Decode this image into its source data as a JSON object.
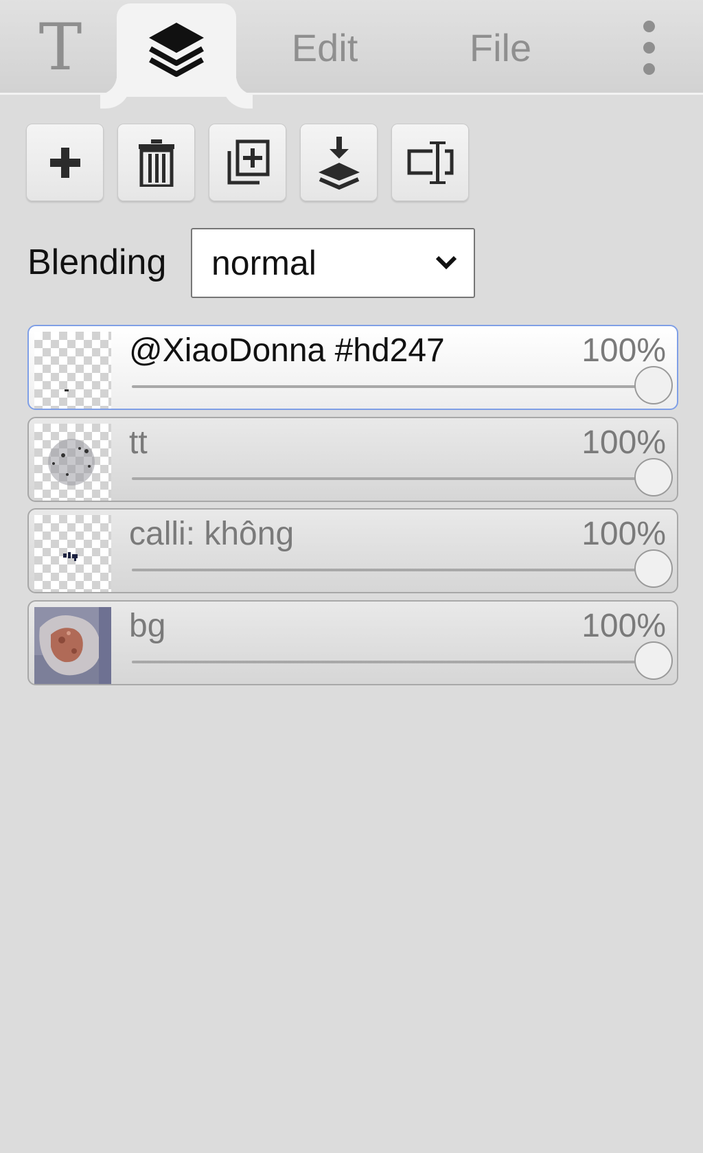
{
  "tabs": {
    "text_tool_glyph": "T",
    "layers_icon": "layers-icon",
    "edit_label": "Edit",
    "file_label": "File",
    "more_icon": "more-vertical-icon"
  },
  "toolbar": [
    {
      "name": "add-layer-button",
      "icon": "plus-icon"
    },
    {
      "name": "delete-layer-button",
      "icon": "trash-icon"
    },
    {
      "name": "duplicate-layer-button",
      "icon": "duplicate-icon"
    },
    {
      "name": "merge-down-button",
      "icon": "merge-down-icon"
    },
    {
      "name": "rename-layer-button",
      "icon": "text-cursor-icon"
    }
  ],
  "blending": {
    "label": "Blending",
    "selected": "normal"
  },
  "layers": [
    {
      "name": "@XiaoDonna #hd247",
      "opacity_text": "100%",
      "opacity": 1.0,
      "active": true,
      "thumb": "mostly-transparent"
    },
    {
      "name": "tt",
      "opacity_text": "100%",
      "opacity": 1.0,
      "active": false,
      "thumb": "gray-circle"
    },
    {
      "name": "calli: không",
      "opacity_text": "100%",
      "opacity": 1.0,
      "active": false,
      "thumb": "small-text-mark"
    },
    {
      "name": "bg",
      "opacity_text": "100%",
      "opacity": 1.0,
      "active": false,
      "thumb": "photo"
    }
  ],
  "colors": {
    "panel_bg": "#dcdcdc",
    "active_border": "#7f9fe6"
  }
}
